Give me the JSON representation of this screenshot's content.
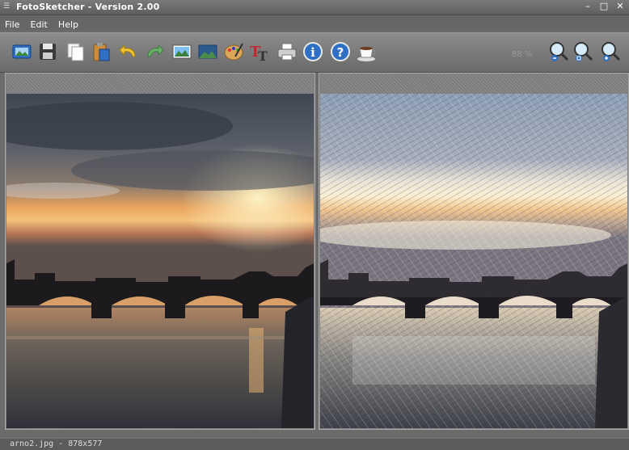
{
  "window": {
    "title": "FotoSketcher - Version 2.00",
    "controls": [
      "minimize-icon",
      "maximize-icon",
      "close-icon"
    ]
  },
  "menu": {
    "items": [
      "File",
      "Edit",
      "Help"
    ]
  },
  "toolbar": {
    "buttons": [
      {
        "name": "open-image-button",
        "icon": "open-image-icon"
      },
      {
        "name": "save-button",
        "icon": "floppy-disk-icon"
      },
      {
        "name": "copy-button",
        "icon": "copy-icon"
      },
      {
        "name": "paste-button",
        "icon": "clipboard-icon"
      },
      {
        "name": "undo-button",
        "icon": "undo-arrow-icon"
      },
      {
        "name": "redo-button",
        "icon": "redo-arrow-icon"
      },
      {
        "name": "original-image-button",
        "icon": "landscape-photo-icon"
      },
      {
        "name": "result-image-button",
        "icon": "landscape-picture-icon"
      },
      {
        "name": "drawing-parameters-button",
        "icon": "paint-palette-icon"
      },
      {
        "name": "add-text-button",
        "icon": "text-tt-icon"
      },
      {
        "name": "print-button",
        "icon": "printer-icon"
      },
      {
        "name": "info-button",
        "icon": "info-icon"
      },
      {
        "name": "help-button",
        "icon": "question-icon"
      },
      {
        "name": "donate-button",
        "icon": "coffee-cup-icon"
      },
      {
        "name": "zoom-out-button",
        "icon": "zoom-out-icon"
      },
      {
        "name": "zoom-fit-button",
        "icon": "zoom-fit-icon"
      },
      {
        "name": "zoom-in-button",
        "icon": "zoom-in-icon"
      }
    ],
    "zoom_value": "88 %"
  },
  "colors": {
    "chrome": "#6b6b6b",
    "panel_frame": "#8d8d8d",
    "sky_dark": "#3f4652",
    "sunset_orange": "#e99a55",
    "water": "#6a6259"
  },
  "panels": {
    "left": {
      "content": "original-photo"
    },
    "right": {
      "content": "sketch-result"
    }
  },
  "status": {
    "text": "arno2.jpg - 878x577"
  }
}
